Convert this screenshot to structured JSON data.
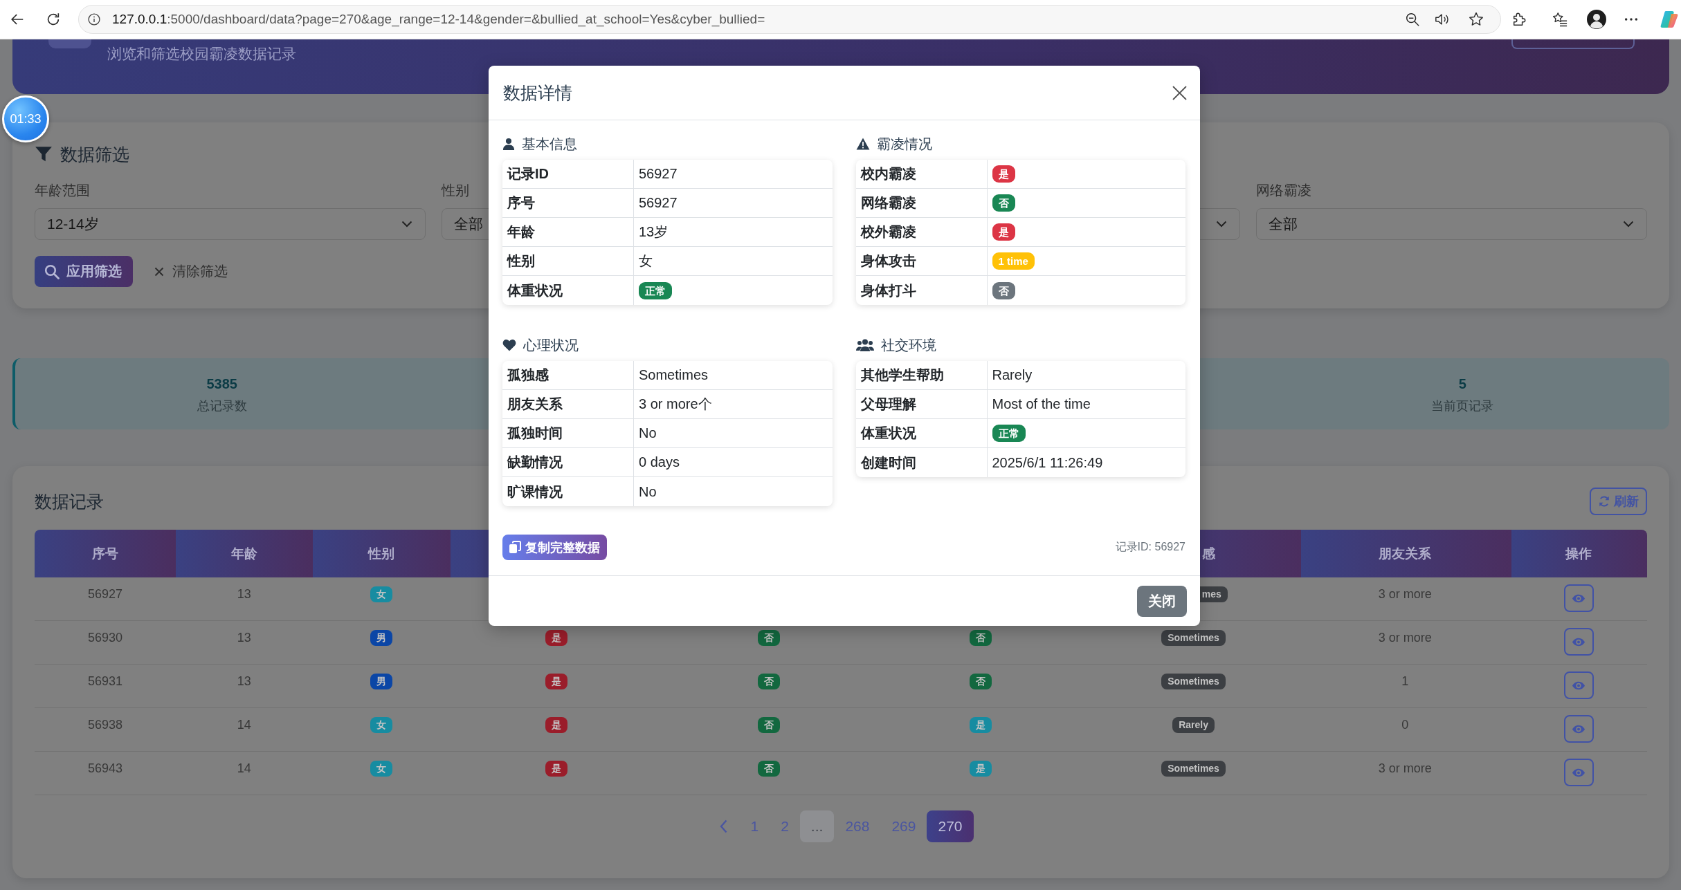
{
  "browser": {
    "url_host": "127.0.0.1",
    "url_path": ":5000/dashboard/data?page=270&age_range=12-14&gender=&bullied_at_school=Yes&cyber_bullied="
  },
  "timer": "01:33",
  "banner": {
    "subtitle": "浏览和筛选校园霸凌数据记录"
  },
  "filters": {
    "title": "数据筛选",
    "fields": [
      {
        "kind": "select",
        "label": "年龄范围",
        "value": "12-14岁"
      },
      {
        "kind": "select",
        "label": "性别",
        "value": "全部"
      },
      {
        "kind": "select"
      },
      {
        "kind": "select",
        "label": "网络霸凌",
        "value": "全部"
      }
    ],
    "apply_button": "应用筛选",
    "clear_button": "清除筛选"
  },
  "stats": [
    {
      "value": "5385",
      "label": "总记录数"
    },
    {
      "value": "5",
      "label": "当前页记录"
    }
  ],
  "records": {
    "title": "数据记录",
    "refresh_button": "刷新",
    "columns": [
      "序号",
      "年龄",
      "性别",
      null,
      null,
      null,
      "感",
      "朋友关系",
      "操作"
    ],
    "rows": [
      {
        "cells": [
          {
            "kind": "text",
            "text": "56927"
          },
          {
            "kind": "text",
            "text": "13"
          },
          {
            "kind": "badge",
            "text": "女",
            "color": "#178ca1"
          },
          null,
          null,
          null,
          {
            "kind": "badge",
            "text": "mes",
            "color": "#3c3f43"
          },
          {
            "kind": "text",
            "text": "3 or more"
          }
        ]
      },
      {
        "cells": [
          {
            "kind": "text",
            "text": "56930"
          },
          {
            "kind": "text",
            "text": "13"
          },
          {
            "kind": "badge",
            "text": "男",
            "color": "#0b46a6"
          },
          {
            "kind": "badge",
            "text": "是",
            "color": "#9a1d2a"
          },
          {
            "kind": "badge",
            "text": "否",
            "color": "#12683f"
          },
          {
            "kind": "badge",
            "text": "否",
            "color": "#12683f"
          },
          {
            "kind": "badge",
            "text": "Sometimes",
            "color": "#3c3f43"
          },
          {
            "kind": "text",
            "text": "3 or more"
          }
        ]
      },
      {
        "cells": [
          {
            "kind": "text",
            "text": "56931"
          },
          {
            "kind": "text",
            "text": "13"
          },
          {
            "kind": "badge",
            "text": "男",
            "color": "#0b46a6"
          },
          {
            "kind": "badge",
            "text": "是",
            "color": "#9a1d2a"
          },
          {
            "kind": "badge",
            "text": "否",
            "color": "#12683f"
          },
          {
            "kind": "badge",
            "text": "否",
            "color": "#12683f"
          },
          {
            "kind": "badge",
            "text": "Sometimes",
            "color": "#3c3f43"
          },
          {
            "kind": "text",
            "text": "1"
          }
        ]
      },
      {
        "cells": [
          {
            "kind": "text",
            "text": "56938"
          },
          {
            "kind": "text",
            "text": "14"
          },
          {
            "kind": "badge",
            "text": "女",
            "color": "#178ca1"
          },
          {
            "kind": "badge",
            "text": "是",
            "color": "#9a1d2a"
          },
          {
            "kind": "badge",
            "text": "否",
            "color": "#12683f"
          },
          {
            "kind": "badge",
            "text": "是",
            "color": "#178ca1"
          },
          {
            "kind": "badge",
            "text": "Rarely",
            "color": "#3c3f43"
          },
          {
            "kind": "text",
            "text": "0"
          }
        ]
      },
      {
        "cells": [
          {
            "kind": "text",
            "text": "56943"
          },
          {
            "kind": "text",
            "text": "14"
          },
          {
            "kind": "badge",
            "text": "女",
            "color": "#178ca1"
          },
          {
            "kind": "badge",
            "text": "是",
            "color": "#9a1d2a"
          },
          {
            "kind": "badge",
            "text": "否",
            "color": "#12683f"
          },
          {
            "kind": "badge",
            "text": "是",
            "color": "#178ca1"
          },
          {
            "kind": "badge",
            "text": "Sometimes",
            "color": "#3c3f43"
          },
          {
            "kind": "text",
            "text": "3 or more"
          }
        ]
      }
    ],
    "pagination": [
      {
        "text": "1",
        "selected": false,
        "disabled": false
      },
      {
        "text": "2",
        "selected": false,
        "disabled": false
      },
      {
        "text": "...",
        "selected": false,
        "disabled": true
      },
      {
        "text": "268",
        "selected": false,
        "disabled": false
      },
      {
        "text": "269",
        "selected": false,
        "disabled": false
      },
      {
        "text": "270",
        "selected": true,
        "disabled": false
      }
    ]
  },
  "modal": {
    "title": "数据详情",
    "sections": [
      {
        "title": "基本信息",
        "rows": [
          {
            "label": "记录ID",
            "kind": "text",
            "value": "56927"
          },
          {
            "label": "序号",
            "kind": "text",
            "value": "56927"
          },
          {
            "label": "年龄",
            "kind": "text",
            "value": "13岁"
          },
          {
            "label": "性别",
            "kind": "text",
            "value": "女"
          },
          {
            "label": "体重状况",
            "kind": "badge",
            "value": "正常",
            "color": "#198754"
          }
        ]
      },
      {
        "title": "霸凌情况",
        "rows": [
          {
            "label": "校内霸凌",
            "kind": "badge",
            "value": "是",
            "color": "#dc3545"
          },
          {
            "label": "网络霸凌",
            "kind": "badge",
            "value": "否",
            "color": "#198754"
          },
          {
            "label": "校外霸凌",
            "kind": "badge",
            "value": "是",
            "color": "#dc3545"
          },
          {
            "label": "身体攻击",
            "kind": "badge",
            "value": "1 time",
            "color": "#ffc107"
          },
          {
            "label": "身体打斗",
            "kind": "badge",
            "value": "否",
            "color": "#6c757d"
          }
        ]
      },
      {
        "title": "心理状况",
        "rows": [
          {
            "label": "孤独感",
            "kind": "text",
            "value": "Sometimes"
          },
          {
            "label": "朋友关系",
            "kind": "text",
            "value": "3 or more个"
          },
          {
            "label": "孤独时间",
            "kind": "text",
            "value": "No"
          },
          {
            "label": "缺勤情况",
            "kind": "text",
            "value": "0 days"
          },
          {
            "label": "旷课情况",
            "kind": "text",
            "value": "No"
          }
        ]
      },
      {
        "title": "社交环境",
        "rows": [
          {
            "label": "其他学生帮助",
            "kind": "text",
            "value": "Rarely"
          },
          {
            "label": "父母理解",
            "kind": "text",
            "value": "Most of the time"
          },
          {
            "label": "体重状况",
            "kind": "badge",
            "value": "正常",
            "color": "#198754"
          },
          {
            "label": "创建时间",
            "kind": "text",
            "value": "2025/6/1 11:26:49"
          }
        ]
      }
    ],
    "copy_button": "复制完整数据",
    "record_id": "记录ID: 56927",
    "close_button": "关闭"
  }
}
